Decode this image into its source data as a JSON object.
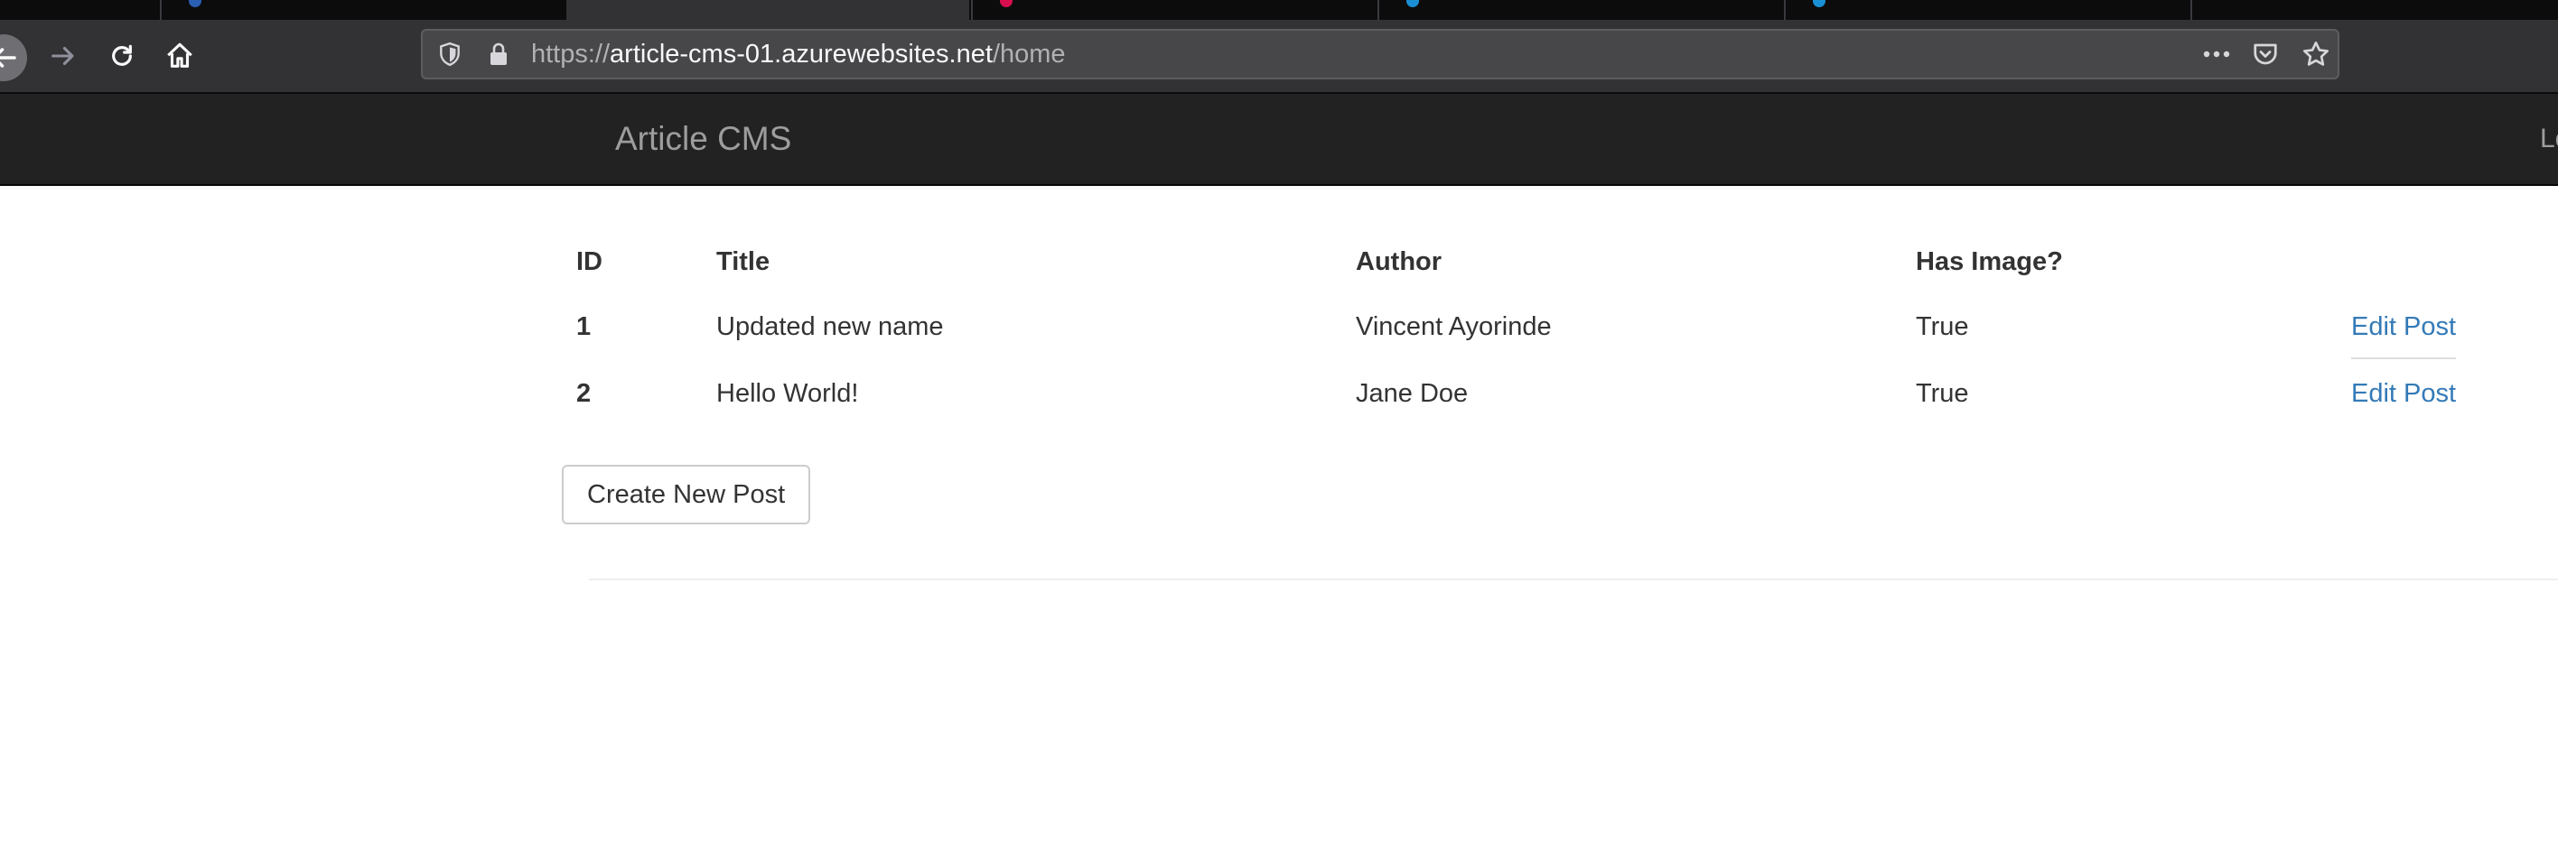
{
  "browser": {
    "url": {
      "scheme": "https://",
      "host": "article-cms-01.azurewebsites.net",
      "path": "/home"
    }
  },
  "site": {
    "brand": "Article CMS",
    "nav_right": "Lo"
  },
  "table": {
    "headers": [
      "ID",
      "Title",
      "Author",
      "Has Image?"
    ],
    "rows": [
      {
        "id": "1",
        "title": "Updated new name",
        "author": "Vincent Ayorinde",
        "has_image": "True",
        "action": "Edit Post"
      },
      {
        "id": "2",
        "title": "Hello World!",
        "author": "Jane Doe",
        "has_image": "True",
        "action": "Edit Post"
      }
    ]
  },
  "create_button": "Create New Post",
  "colors": {
    "link": "#337ab7",
    "navbar": "#222222",
    "browser_toolbar": "#323234"
  }
}
